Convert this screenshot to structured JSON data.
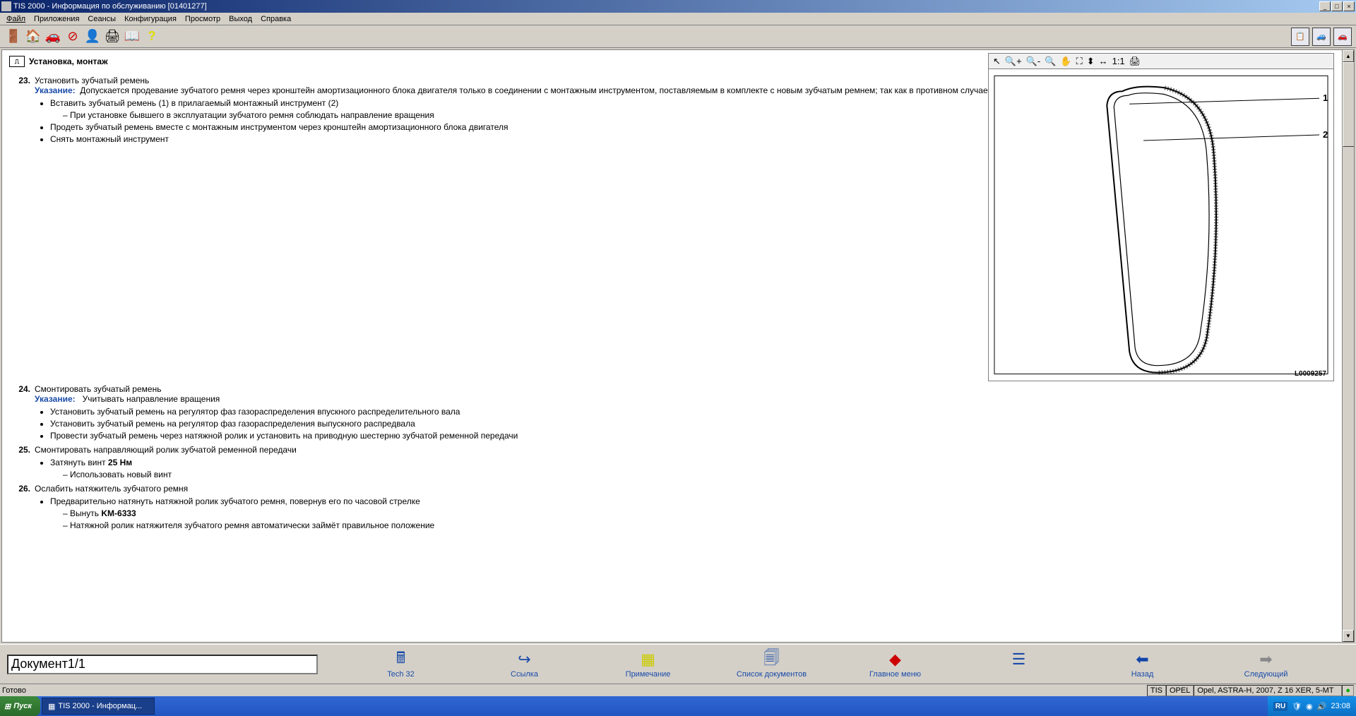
{
  "title": "TIS 2000 - Информация по обслуживанию [01401277]",
  "menu": [
    "Файл",
    "Приложения",
    "Сеансы",
    "Конфигурация",
    "Просмотр",
    "Выход",
    "Справка"
  ],
  "section_title": "Установка, монтаж",
  "steps": {
    "s23": {
      "num": "23.",
      "title": "Установить зубчатый ремень",
      "note_label": "Указание:",
      "note_text": "Допускается продевание зубчатого ремня через кронштейн амортизационного блока двигателя только в соединении с монтажным инструментом, поставляемым в комплекте с новым зубчатым ремнем; так как в противном случае возможно повреждение зубчатого ремня при изгибе",
      "b1": "Вставить зубчатый ремень (1) в прилагаемый монтажный инструмент (2)",
      "b1s1": "При установке бывшего в эксплуатации зубчатого ремня соблюдать направление вращения",
      "b2": "Продеть зубчатый ремень вместе с монтажным инструментом через кронштейн амортизационного блока двигателя",
      "b3": "Снять монтажный инструмент"
    },
    "s24": {
      "num": "24.",
      "title": "Смонтировать зубчатый ремень",
      "note_label": "Указание:",
      "note_text": "Учитывать направление вращения",
      "b1": "Установить зубчатый ремень на регулятор фаз газораспределения впускного распределительного вала",
      "b2": "Установить зубчатый ремень на регулятор фаз газораспределения выпускного распредвала",
      "b3": "Провести зубчатый ремень через натяжной ролик и установить на приводную шестерню зубчатой ременной передачи"
    },
    "s25": {
      "num": "25.",
      "title": "Смонтировать направляющий ролик зубчатой ременной передачи",
      "b1a": "Затянуть винт ",
      "b1b": "25 Нм",
      "b1s1": "Использовать новый винт"
    },
    "s26": {
      "num": "26.",
      "title": "Ослабить натяжитель зубчатого ремня",
      "b1": "Предварительно натянуть натяжной ролик зубчатого ремня, повернув его по часовой стрелке",
      "b1s1a": "Вынуть ",
      "b1s1b": "KM-6333",
      "b1s2": "Натяжной ролик натяжителя зубчатого ремня автоматически займёт правильное положение"
    }
  },
  "diagram": {
    "id": "L0009257",
    "label1": "1",
    "label2": "2"
  },
  "bottom_doc": "Документ1/1",
  "bottom_btns": [
    "Tech 32",
    "Ссылка",
    "Примечание",
    "Список документов",
    "Главное меню",
    "Назад",
    "Следующий"
  ],
  "status_ready": "Готово",
  "status_tis": "TIS",
  "status_make": "OPEL",
  "status_vehicle": "Opel, ASTRA-H, 2007, Z 16 XER, 5-MT",
  "taskbar_start": "Пуск",
  "taskbar_app": "TIS 2000 - Информац...",
  "tray_lang": "RU",
  "tray_time": "23:08"
}
